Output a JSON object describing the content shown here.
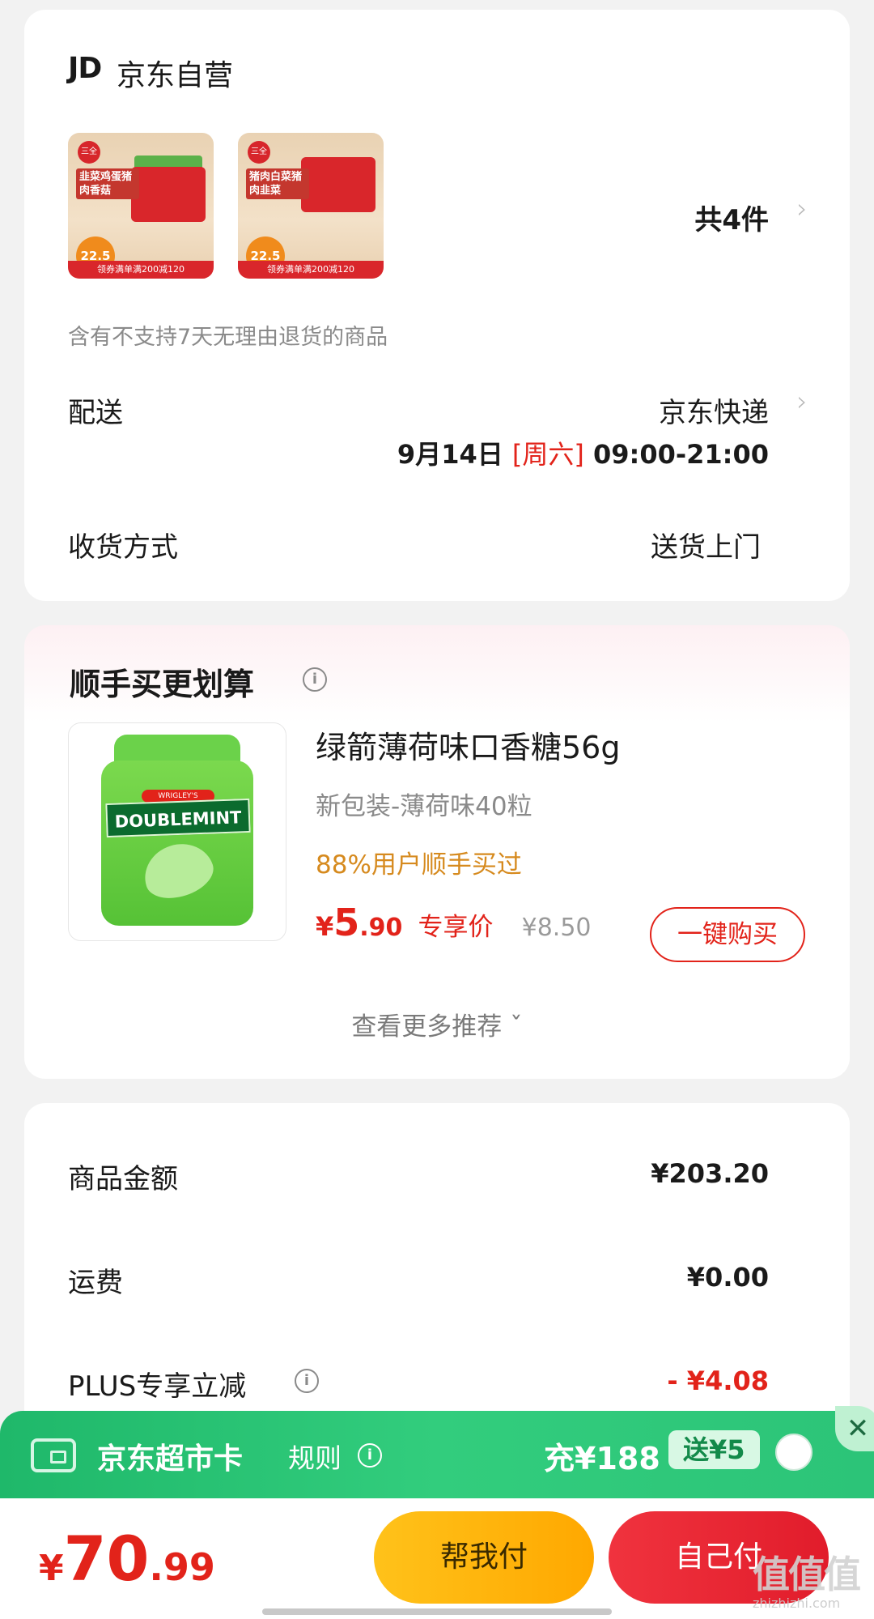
{
  "shop": {
    "logo_text": "JD",
    "name": "京东自营",
    "item_count": "共4件",
    "chevron": "›",
    "notice": "含有不支持7天无理由退货的商品",
    "thumbnails": [
      {
        "badge": "22.5",
        "label": "韭菜鸡蛋猪肉香菇",
        "banner": "领券满单满200减120"
      },
      {
        "badge": "22.5",
        "label": "猪肉白菜猪肉韭菜",
        "banner": "领券满单满200减120"
      }
    ]
  },
  "delivery": {
    "label": "配送",
    "courier": "京东快递",
    "date": "9月14日",
    "weekday": "[周六]",
    "time": "09:00-21:00"
  },
  "receive": {
    "label": "收货方式",
    "value": "送货上门"
  },
  "recommend": {
    "title": "顺手买更划算",
    "info_icon": "i",
    "product": {
      "name": "绿箭薄荷味口香糖56g",
      "spec": "新包装-薄荷味40粒",
      "bought": "88%用户顺手买过",
      "price_symbol": "¥",
      "price_int": "5",
      "price_dec": ".90",
      "price_tag": "专享价",
      "original_price": "¥8.50",
      "buy_label": "一键购买",
      "image_label": "DOUBLEMINT",
      "image_brand": "WRIGLEY'S"
    },
    "more_label": "查看更多推荐 ˇ"
  },
  "summary": {
    "goods_label": "商品金额",
    "goods_value": "¥203.20",
    "shipping_label": "运费",
    "shipping_value": "¥0.00",
    "plus_label": "PLUS专享立减",
    "plus_info": "i",
    "plus_value": "- ¥4.08"
  },
  "market_card": {
    "title": "京东超市卡",
    "rule": "规则",
    "info": "i",
    "recharge": "充¥188",
    "gift": "送¥5",
    "close": "✕"
  },
  "footer": {
    "total_symbol": "¥",
    "total_int": "70",
    "total_dec": ".99",
    "pay_friend": "帮我付",
    "pay_self": "自己付",
    "watermark": "值值值",
    "watermark_sub": "zhizhizhi.com"
  },
  "colors": {
    "accent_red": "#e2231a",
    "bought_orange": "#d68a1e",
    "banner_green": "#32cd7d",
    "pay_friend_yellow": "#ffc21a",
    "pay_self_red": "#e11c2b"
  }
}
